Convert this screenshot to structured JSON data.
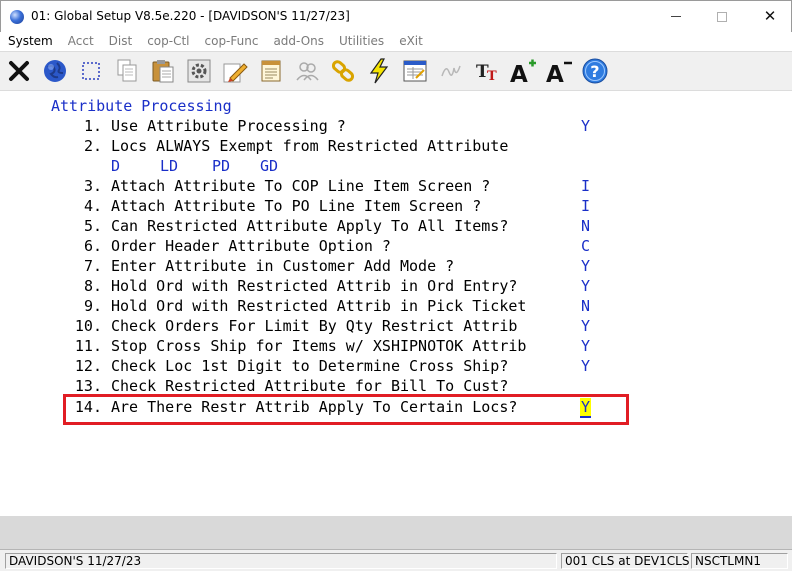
{
  "window": {
    "title": "01: Global Setup V8.5e.220 - [DAVIDSON'S 11/27/23]",
    "minimize_glyph": "",
    "maximize_glyph": "",
    "close_glyph": "✕"
  },
  "menu": {
    "items": [
      {
        "label": "System"
      },
      {
        "label": "Acct"
      },
      {
        "label": "Dist"
      },
      {
        "label": "cop-Ctl"
      },
      {
        "label": "cop-Func"
      },
      {
        "label": "add-Ons"
      },
      {
        "label": "Utilities"
      },
      {
        "label": "eXit"
      }
    ]
  },
  "toolbar": {
    "icons": [
      "close-x-icon",
      "globe-icon",
      "select-rect-icon",
      "copy-icon",
      "paste-icon",
      "settings-gear-icon",
      "edit-pencil-icon",
      "notes-icon",
      "users-icon",
      "link-icon",
      "lightning-icon",
      "window-table-icon",
      "signature-icon",
      "font-tt-icon",
      "font-grow-icon",
      "font-shrink-icon",
      "help-icon"
    ]
  },
  "screen": {
    "heading": "Attribute Processing",
    "items": [
      {
        "num": "1.",
        "label": "Use Attribute Processing ?",
        "value": "Y"
      },
      {
        "num": "2.",
        "label": "Locs ALWAYS Exempt from Restricted Attribute",
        "value": ""
      },
      {
        "num": "3.",
        "label": "Attach Attribute To COP Line Item Screen ?",
        "value": "I"
      },
      {
        "num": "4.",
        "label": "Attach Attribute To PO Line Item Screen ?",
        "value": "I"
      },
      {
        "num": "5.",
        "label": "Can Restricted Attribute Apply To All Items?",
        "value": "N"
      },
      {
        "num": "6.",
        "label": "Order Header Attribute Option ?",
        "value": "C"
      },
      {
        "num": "7.",
        "label": "Enter Attribute in Customer Add Mode ?",
        "value": "Y"
      },
      {
        "num": "8.",
        "label": "Hold Ord with Restricted Attrib in Ord Entry?",
        "value": "Y"
      },
      {
        "num": "9.",
        "label": "Hold Ord with Restricted Attrib in Pick Ticket",
        "value": "N"
      },
      {
        "num": "10.",
        "label": "Check Orders For Limit By Qty Restrict Attrib",
        "value": "Y"
      },
      {
        "num": "11.",
        "label": "Stop Cross Ship for Items w/ XSHIPNOTOK Attrib",
        "value": "Y"
      },
      {
        "num": "12.",
        "label": "Check Loc 1st Digit to Determine Cross Ship?",
        "value": "Y"
      },
      {
        "num": "13.",
        "label": "Check Restricted Attribute for Bill To Cust?",
        "value": ""
      },
      {
        "num": "14.",
        "label": "Are There Restr Attrib Apply To Certain Locs?",
        "value": "Y"
      }
    ],
    "exempt_locs": [
      "D",
      "LD",
      "PD",
      "GD"
    ]
  },
  "status": {
    "company": "DAVIDSON'S 11/27/23",
    "session": "001 CLS at DEV1CLS",
    "program": "NSCTLMN1"
  }
}
